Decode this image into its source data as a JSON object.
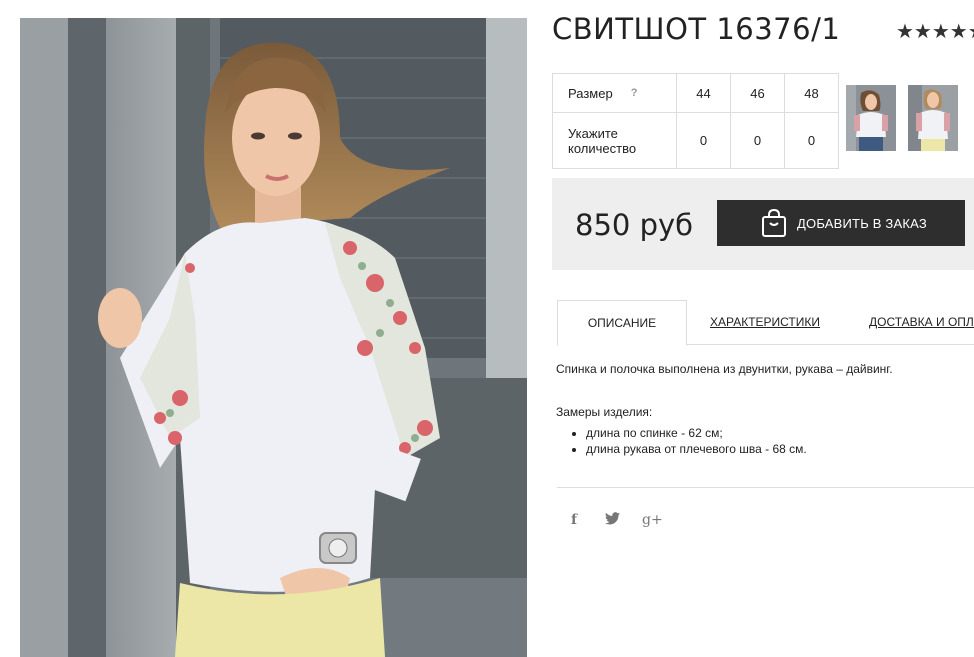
{
  "product": {
    "title": "СВИТШОТ 16376/1",
    "rating_stars": "★★★★★",
    "rating_value": 5
  },
  "sizes": {
    "size_label": "Размер",
    "help_icon": "question-icon",
    "help_text": "?",
    "quantity_label": "Укажите количество",
    "columns": [
      "44",
      "46",
      "48"
    ],
    "quantities": [
      "0",
      "0",
      "0"
    ]
  },
  "purchase": {
    "price": "850 руб",
    "add_button": "ДОБАВИТЬ В ЗАКАЗ",
    "button_icon": "shopping-bag-icon",
    "colors": {
      "button_bg": "#2e2e2e",
      "box_bg": "#eeeeee"
    }
  },
  "tabs": [
    {
      "label": "ОПИСАНИЕ",
      "active": true
    },
    {
      "label": "ХАРАКТЕРИСТИКИ",
      "active": false
    },
    {
      "label": "ДОСТАВКА И ОПЛАТА",
      "active": false
    }
  ],
  "description": {
    "text": "Спинка и полочка выполнена из двунитки, рукава – дайвинг.",
    "measures_title": "Замеры изделия:",
    "measures": [
      "длина по спинке - 62 см;",
      "длина рукава от плечевого шва - 68 см."
    ]
  },
  "social": [
    {
      "icon": "facebook-icon",
      "glyph": "f"
    },
    {
      "icon": "twitter-icon",
      "glyph": "t"
    },
    {
      "icon": "google-plus-icon",
      "glyph": "g+"
    }
  ]
}
